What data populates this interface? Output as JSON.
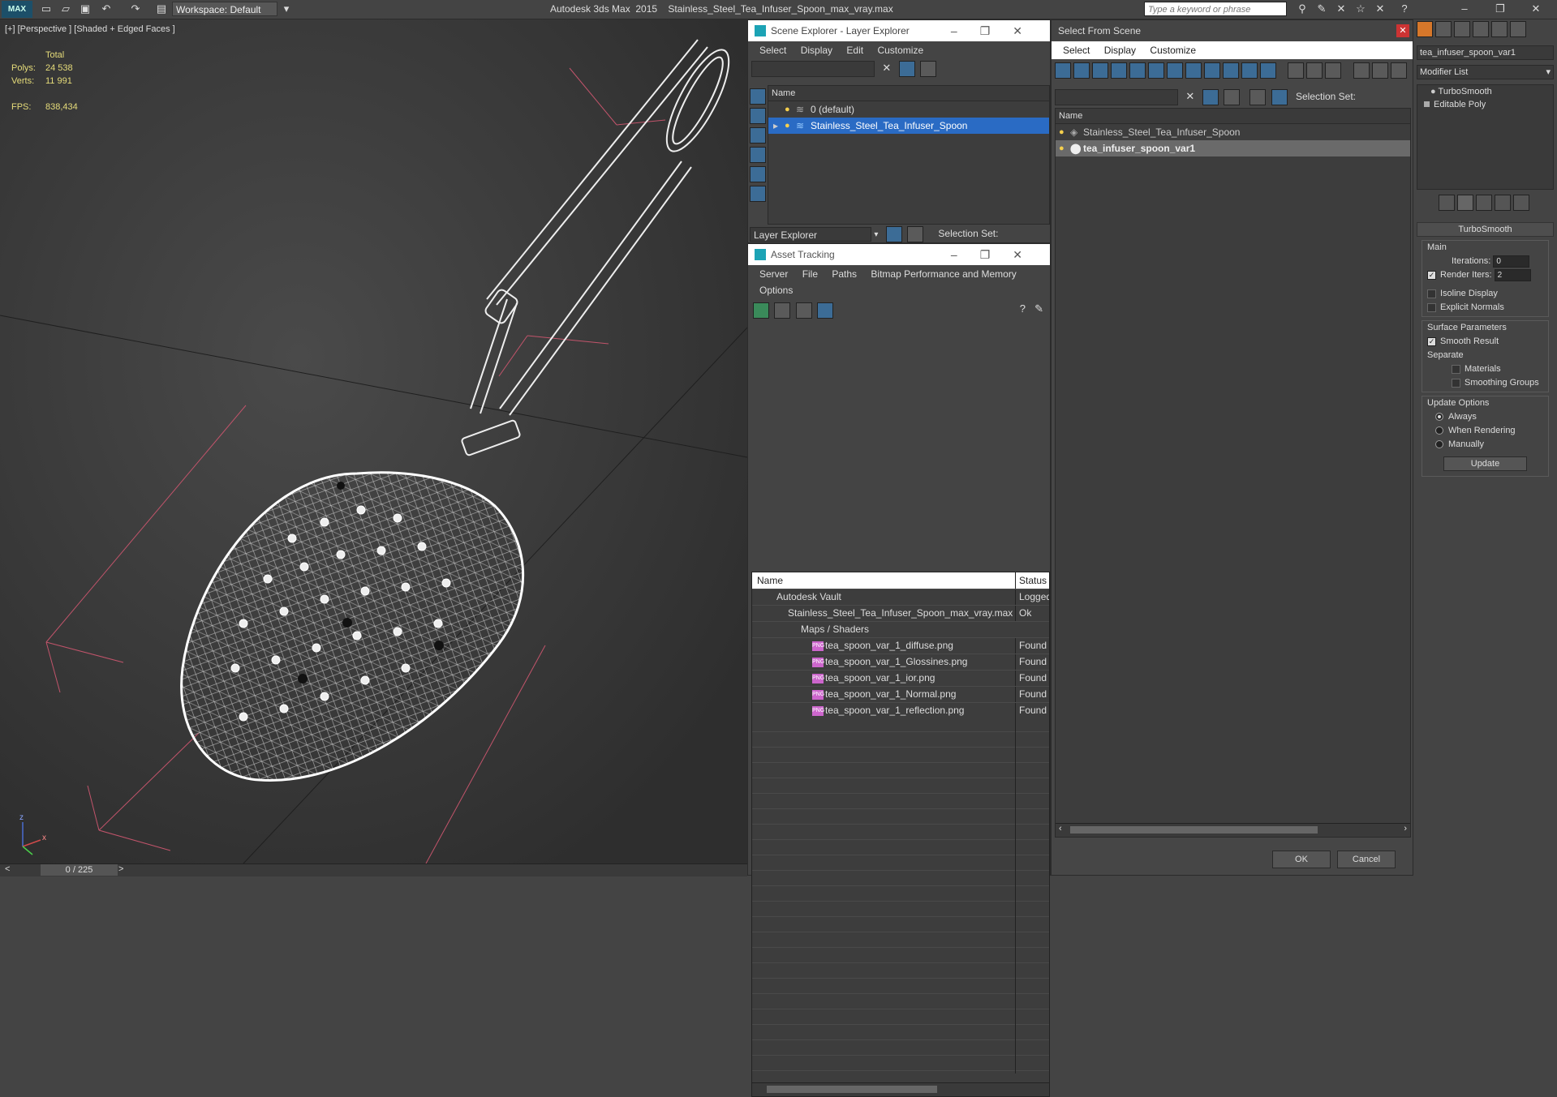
{
  "titlebar": {
    "logo": "MAX",
    "workspace": "Workspace: Default",
    "app_title": "Autodesk 3ds Max  2015    Stainless_Steel_Tea_Infuser_Spoon_max_vray.max",
    "search_placeholder": "Type a keyword or phrase"
  },
  "viewport": {
    "label": "[+] [Perspective ] [Shaded + Edged Faces ]",
    "stats": {
      "total_label": "Total",
      "polys_label": "Polys:",
      "polys_value": "24 538",
      "verts_label": "Verts:",
      "verts_value": "11 991",
      "fps_label": "FPS:",
      "fps_value": "838,434"
    },
    "axis": {
      "z": "z",
      "x": "x"
    }
  },
  "timeline": {
    "frame": "0 / 225",
    "prev": "<",
    "next": ">"
  },
  "scene_explorer": {
    "title": "Scene Explorer - Layer Explorer",
    "menu": [
      "Select",
      "Display",
      "Edit",
      "Customize"
    ],
    "column": "Name",
    "rows": [
      {
        "label": "0 (default)"
      },
      {
        "label": "Stainless_Steel_Tea_Infuser_Spoon"
      }
    ],
    "footer_dropdown": "Layer Explorer",
    "selection_set_label": "Selection Set:"
  },
  "asset_tracking": {
    "title": "Asset Tracking",
    "menu": [
      "Server",
      "File",
      "Paths",
      "Bitmap Performance and Memory"
    ],
    "menu2": "Options",
    "col_name": "Name",
    "col_status": "Status",
    "rows": [
      {
        "name": "Autodesk Vault",
        "status": "Logged"
      },
      {
        "name": "Stainless_Steel_Tea_Infuser_Spoon_max_vray.max",
        "status": "Ok"
      },
      {
        "name": "Maps / Shaders",
        "status": ""
      },
      {
        "name": "tea_spoon_var_1_diffuse.png",
        "status": "Found"
      },
      {
        "name": "tea_spoon_var_1_Glossines.png",
        "status": "Found"
      },
      {
        "name": "tea_spoon_var_1_ior.png",
        "status": "Found"
      },
      {
        "name": "tea_spoon_var_1_Normal.png",
        "status": "Found"
      },
      {
        "name": "tea_spoon_var_1_reflection.png",
        "status": "Found"
      }
    ],
    "png_badge": "PNG"
  },
  "select_from_scene": {
    "title": "Select From Scene",
    "menu": [
      "Select",
      "Display",
      "Customize"
    ],
    "selection_set_label": "Selection Set:",
    "column": "Name",
    "rows": [
      {
        "label": "Stainless_Steel_Tea_Infuser_Spoon"
      },
      {
        "label": "tea_infuser_spoon_var1"
      }
    ],
    "ok": "OK",
    "cancel": "Cancel"
  },
  "command_panel": {
    "object_name": "tea_infuser_spoon_var1",
    "modifier_list": "Modifier List",
    "stack": [
      "TurboSmooth",
      "Editable Poly"
    ],
    "rollout_title": "TurboSmooth",
    "main_group": "Main",
    "iterations_label": "Iterations:",
    "iterations_value": "0",
    "render_iters_label": "Render Iters:",
    "render_iters_value": "2",
    "isoline_label": "Isoline Display",
    "explicit_normals_label": "Explicit Normals",
    "surface_group": "Surface Parameters",
    "smooth_result_label": "Smooth Result",
    "separate_label": "Separate",
    "materials_label": "Materials",
    "smoothing_groups_label": "Smoothing Groups",
    "update_group": "Update Options",
    "always_label": "Always",
    "when_rendering_label": "When Rendering",
    "manually_label": "Manually",
    "update_button": "Update"
  }
}
